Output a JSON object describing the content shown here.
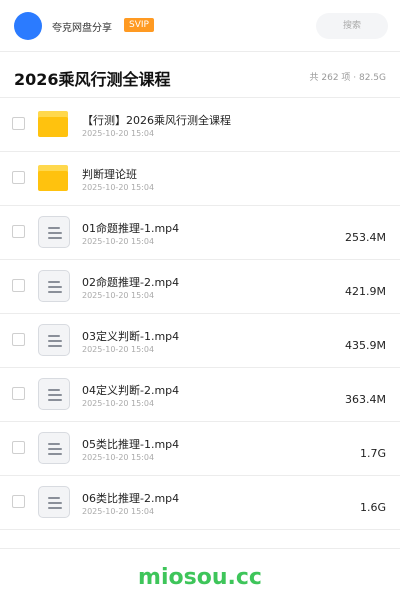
{
  "header": {
    "user_name": "夸克网盘分享",
    "badge": "SVIP",
    "search_placeholder": "搜索",
    "accent_color": "#2b7bff",
    "badge_color": "#ff9a22"
  },
  "folder": {
    "title": "2026乘风行测全课程",
    "summary": "共 262 项 · 82.5G"
  },
  "items": [
    {
      "type": "folder",
      "icon": "folder-icon",
      "name": "【行测】2026乘风行测全课程",
      "date": "2025-10-20 15:04",
      "size": ""
    },
    {
      "type": "folder",
      "icon": "folder-icon",
      "name": "判断理论班",
      "date": "2025-10-20 15:04",
      "size": ""
    },
    {
      "type": "file",
      "icon": "document-icon",
      "name": "01命题推理-1.mp4",
      "date": "2025-10-20 15:04",
      "size": "253.4M"
    },
    {
      "type": "file",
      "icon": "document-icon",
      "name": "02命题推理-2.mp4",
      "date": "2025-10-20 15:04",
      "size": "421.9M"
    },
    {
      "type": "file",
      "icon": "document-icon",
      "name": "03定义判断-1.mp4",
      "date": "2025-10-20 15:04",
      "size": "435.9M"
    },
    {
      "type": "file",
      "icon": "document-icon",
      "name": "04定义判断-2.mp4",
      "date": "2025-10-20 15:04",
      "size": "363.4M"
    },
    {
      "type": "file",
      "icon": "document-icon",
      "name": "05类比推理-1.mp4",
      "date": "2025-10-20 15:04",
      "size": "1.7G"
    },
    {
      "type": "file",
      "icon": "document-icon",
      "name": "06类比推理-2.mp4",
      "date": "2025-10-20 15:04",
      "size": "1.6G"
    }
  ],
  "footer": {
    "brand": "miosou.cc",
    "brand_color": "#3ec55a"
  }
}
